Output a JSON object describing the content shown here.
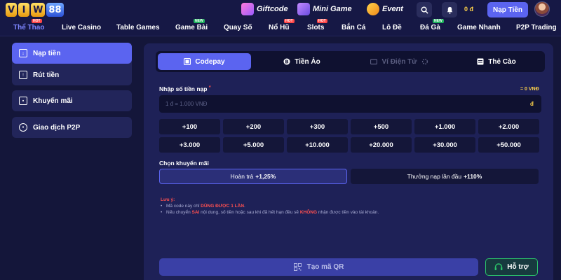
{
  "header": {
    "logo_parts": [
      "V",
      "I",
      "W",
      "88"
    ],
    "promos": [
      {
        "label": "Giftcode",
        "icon": "gift-icon"
      },
      {
        "label": "Mini Game",
        "icon": "arcade-icon"
      },
      {
        "label": "Event",
        "icon": "trophy-icon"
      }
    ],
    "balance": "0 đ",
    "deposit_label": "Nạp Tiền"
  },
  "nav": {
    "items": [
      {
        "label": "Thể Thao",
        "tag": "HOT",
        "active": true
      },
      {
        "label": "Live Casino",
        "tag": ""
      },
      {
        "label": "Table Games",
        "tag": ""
      },
      {
        "label": "Game Bài",
        "tag": "NEW"
      },
      {
        "label": "Quay Số",
        "tag": ""
      },
      {
        "label": "Nổ Hũ",
        "tag": "HOT"
      },
      {
        "label": "Slots",
        "tag": "HOT"
      },
      {
        "label": "Bắn Cá",
        "tag": ""
      },
      {
        "label": "Lô Đề",
        "tag": ""
      },
      {
        "label": "Đá Gà",
        "tag": "NEW"
      },
      {
        "label": "Game Nhanh",
        "tag": ""
      },
      {
        "label": "P2P Trading",
        "tag": ""
      }
    ]
  },
  "sidebar": {
    "items": [
      {
        "label": "Nạp tiền",
        "icon": "wallet-in-icon",
        "active": true
      },
      {
        "label": "Rút tiền",
        "icon": "wallet-out-icon"
      },
      {
        "label": "Khuyến mãi",
        "icon": "gift-icon"
      },
      {
        "label": "Giao dịch P2P",
        "icon": "users-icon"
      }
    ]
  },
  "tabs": [
    {
      "label": "Codepay",
      "icon": "codepay-icon",
      "active": true
    },
    {
      "label": "Tiền Ảo",
      "icon": "crypto-icon"
    },
    {
      "label": "Ví Điện Tử",
      "icon": "ewallet-icon",
      "disabled": true
    },
    {
      "label": "Thẻ Cào",
      "icon": "card-icon"
    }
  ],
  "form": {
    "amount_label": "Nhập số tiền nạp",
    "required_mark": "*",
    "conversion": "= 0 VNĐ",
    "placeholder": "1 đ = 1.000 VNĐ",
    "currency": "đ",
    "quick_amounts": [
      "+100",
      "+200",
      "+300",
      "+500",
      "+1.000",
      "+2.000",
      "+3.000",
      "+5.000",
      "+10.000",
      "+20.000",
      "+30.000",
      "+50.000"
    ],
    "promo_label": "Chọn khuyến mãi",
    "promo_options": [
      {
        "label": "Hoàn trả",
        "value": "+1,25%",
        "selected": true
      },
      {
        "label": "Thưởng nạp lần đầu",
        "value": "+110%"
      }
    ]
  },
  "notes": {
    "title": "Lưu ý:",
    "line1_pre": "Mã code này chỉ",
    "line1_hl": "DÙNG ĐƯỢC 1 LẦN",
    "line1_post": ".",
    "line2_a": "Nếu chuyển",
    "line2_hl1": "SAI",
    "line2_b": "nội dung, số tiền hoặc sau khi đã hết hạn đều sẽ",
    "line2_hl2": "KHÔNG",
    "line2_c": "nhận được tiền vào tài khoản."
  },
  "actions": {
    "qr_label": "Tạo mã QR",
    "help_label": "Hỗ trợ"
  },
  "colors": {
    "accent": "#5b64f0",
    "background": "#14163a",
    "warning": "#ff5050",
    "gold": "#ffd34a",
    "support": "#2bc46a"
  }
}
